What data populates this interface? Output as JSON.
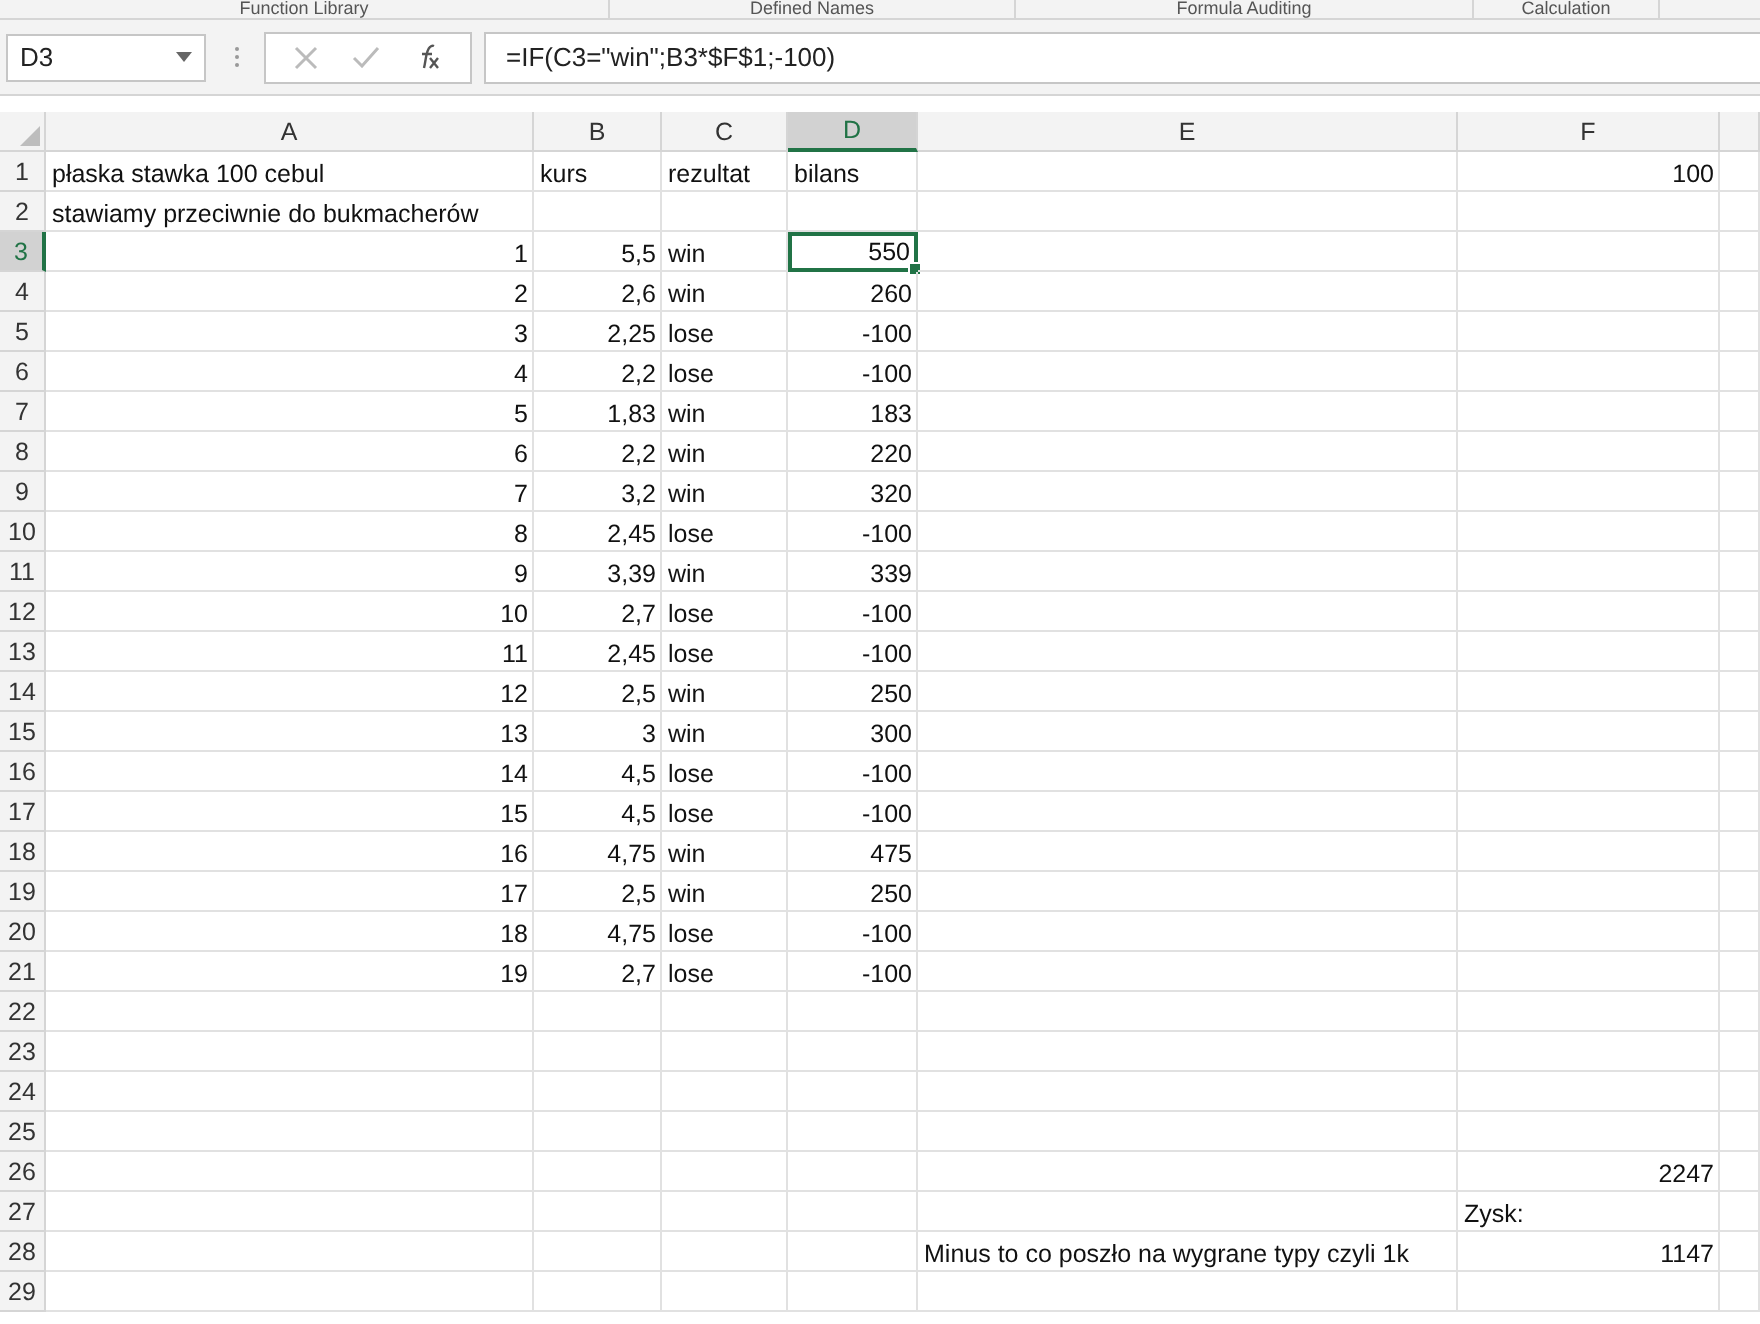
{
  "ribbon_groups": [
    {
      "label": "Function Library"
    },
    {
      "label": "Defined Names"
    },
    {
      "label": "Formula Auditing"
    },
    {
      "label": "Calculation"
    }
  ],
  "formula_bar": {
    "name_box": "D3",
    "formula": "=IF(C3=\"win\";B3*$F$1;-100)"
  },
  "columns": [
    {
      "label": "A",
      "selected": false
    },
    {
      "label": "B",
      "selected": false
    },
    {
      "label": "C",
      "selected": false
    },
    {
      "label": "D",
      "selected": true
    },
    {
      "label": "E",
      "selected": false
    },
    {
      "label": "F",
      "selected": false
    }
  ],
  "rows": [
    {
      "number": "1",
      "selected": false,
      "cells": [
        {
          "text": "płaska stawka 100 cebul",
          "kind": "text"
        },
        {
          "text": "kurs",
          "kind": "text"
        },
        {
          "text": "rezultat",
          "kind": "text"
        },
        {
          "text": "bilans",
          "kind": "text"
        },
        {},
        {
          "text": "100",
          "kind": "number"
        }
      ]
    },
    {
      "number": "2",
      "selected": false,
      "cells": [
        {
          "text": "stawiamy przeciwnie do bukmacherów",
          "kind": "text"
        }
      ]
    },
    {
      "number": "3",
      "selected": true,
      "cells": [
        {
          "text": "1",
          "kind": "number"
        },
        {
          "text": "5,5",
          "kind": "number"
        },
        {
          "text": "win",
          "kind": "text"
        },
        {
          "text": "550",
          "kind": "number"
        }
      ]
    },
    {
      "number": "4",
      "selected": false,
      "cells": [
        {
          "text": "2",
          "kind": "number"
        },
        {
          "text": "2,6",
          "kind": "number"
        },
        {
          "text": "win",
          "kind": "text"
        },
        {
          "text": "260",
          "kind": "number"
        }
      ]
    },
    {
      "number": "5",
      "selected": false,
      "cells": [
        {
          "text": "3",
          "kind": "number"
        },
        {
          "text": "2,25",
          "kind": "number"
        },
        {
          "text": "lose",
          "kind": "text"
        },
        {
          "text": "-100",
          "kind": "number"
        }
      ]
    },
    {
      "number": "6",
      "selected": false,
      "cells": [
        {
          "text": "4",
          "kind": "number"
        },
        {
          "text": "2,2",
          "kind": "number"
        },
        {
          "text": "lose",
          "kind": "text"
        },
        {
          "text": "-100",
          "kind": "number"
        }
      ]
    },
    {
      "number": "7",
      "selected": false,
      "cells": [
        {
          "text": "5",
          "kind": "number"
        },
        {
          "text": "1,83",
          "kind": "number"
        },
        {
          "text": "win",
          "kind": "text"
        },
        {
          "text": "183",
          "kind": "number"
        }
      ]
    },
    {
      "number": "8",
      "selected": false,
      "cells": [
        {
          "text": "6",
          "kind": "number"
        },
        {
          "text": "2,2",
          "kind": "number"
        },
        {
          "text": "win",
          "kind": "text"
        },
        {
          "text": "220",
          "kind": "number"
        }
      ]
    },
    {
      "number": "9",
      "selected": false,
      "cells": [
        {
          "text": "7",
          "kind": "number"
        },
        {
          "text": "3,2",
          "kind": "number"
        },
        {
          "text": "win",
          "kind": "text"
        },
        {
          "text": "320",
          "kind": "number"
        }
      ]
    },
    {
      "number": "10",
      "selected": false,
      "cells": [
        {
          "text": "8",
          "kind": "number"
        },
        {
          "text": "2,45",
          "kind": "number"
        },
        {
          "text": "lose",
          "kind": "text"
        },
        {
          "text": "-100",
          "kind": "number"
        }
      ]
    },
    {
      "number": "11",
      "selected": false,
      "cells": [
        {
          "text": "9",
          "kind": "number"
        },
        {
          "text": "3,39",
          "kind": "number"
        },
        {
          "text": "win",
          "kind": "text"
        },
        {
          "text": "339",
          "kind": "number"
        }
      ]
    },
    {
      "number": "12",
      "selected": false,
      "cells": [
        {
          "text": "10",
          "kind": "number"
        },
        {
          "text": "2,7",
          "kind": "number"
        },
        {
          "text": "lose",
          "kind": "text"
        },
        {
          "text": "-100",
          "kind": "number"
        }
      ]
    },
    {
      "number": "13",
      "selected": false,
      "cells": [
        {
          "text": "11",
          "kind": "number"
        },
        {
          "text": "2,45",
          "kind": "number"
        },
        {
          "text": "lose",
          "kind": "text"
        },
        {
          "text": "-100",
          "kind": "number"
        }
      ]
    },
    {
      "number": "14",
      "selected": false,
      "cells": [
        {
          "text": "12",
          "kind": "number"
        },
        {
          "text": "2,5",
          "kind": "number"
        },
        {
          "text": "win",
          "kind": "text"
        },
        {
          "text": "250",
          "kind": "number"
        }
      ]
    },
    {
      "number": "15",
      "selected": false,
      "cells": [
        {
          "text": "13",
          "kind": "number"
        },
        {
          "text": "3",
          "kind": "number"
        },
        {
          "text": "win",
          "kind": "text"
        },
        {
          "text": "300",
          "kind": "number"
        }
      ]
    },
    {
      "number": "16",
      "selected": false,
      "cells": [
        {
          "text": "14",
          "kind": "number"
        },
        {
          "text": "4,5",
          "kind": "number"
        },
        {
          "text": "lose",
          "kind": "text"
        },
        {
          "text": "-100",
          "kind": "number"
        }
      ]
    },
    {
      "number": "17",
      "selected": false,
      "cells": [
        {
          "text": "15",
          "kind": "number"
        },
        {
          "text": "4,5",
          "kind": "number"
        },
        {
          "text": "lose",
          "kind": "text"
        },
        {
          "text": "-100",
          "kind": "number"
        }
      ]
    },
    {
      "number": "18",
      "selected": false,
      "cells": [
        {
          "text": "16",
          "kind": "number"
        },
        {
          "text": "4,75",
          "kind": "number"
        },
        {
          "text": "win",
          "kind": "text"
        },
        {
          "text": "475",
          "kind": "number"
        }
      ]
    },
    {
      "number": "19",
      "selected": false,
      "cells": [
        {
          "text": "17",
          "kind": "number"
        },
        {
          "text": "2,5",
          "kind": "number"
        },
        {
          "text": "win",
          "kind": "text"
        },
        {
          "text": "250",
          "kind": "number"
        }
      ]
    },
    {
      "number": "20",
      "selected": false,
      "cells": [
        {
          "text": "18",
          "kind": "number"
        },
        {
          "text": "4,75",
          "kind": "number"
        },
        {
          "text": "lose",
          "kind": "text"
        },
        {
          "text": "-100",
          "kind": "number"
        }
      ]
    },
    {
      "number": "21",
      "selected": false,
      "cells": [
        {
          "text": "19",
          "kind": "number"
        },
        {
          "text": "2,7",
          "kind": "number"
        },
        {
          "text": "lose",
          "kind": "text"
        },
        {
          "text": "-100",
          "kind": "number"
        }
      ]
    },
    {
      "number": "22",
      "selected": false,
      "cells": []
    },
    {
      "number": "23",
      "selected": false,
      "cells": []
    },
    {
      "number": "24",
      "selected": false,
      "cells": []
    },
    {
      "number": "25",
      "selected": false,
      "cells": []
    },
    {
      "number": "26",
      "selected": false,
      "cells": [
        {},
        {},
        {},
        {},
        {},
        {
          "text": "2247",
          "kind": "number"
        }
      ]
    },
    {
      "number": "27",
      "selected": false,
      "cells": [
        {},
        {},
        {},
        {},
        {},
        {
          "text": "Zysk:",
          "kind": "text"
        }
      ]
    },
    {
      "number": "28",
      "selected": false,
      "cells": [
        {},
        {},
        {},
        {},
        {
          "text": "Minus to co poszło na wygrane typy czyli 1k",
          "kind": "text"
        },
        {
          "text": "1147",
          "kind": "number"
        }
      ]
    },
    {
      "number": "29",
      "selected": false,
      "cells": []
    }
  ]
}
